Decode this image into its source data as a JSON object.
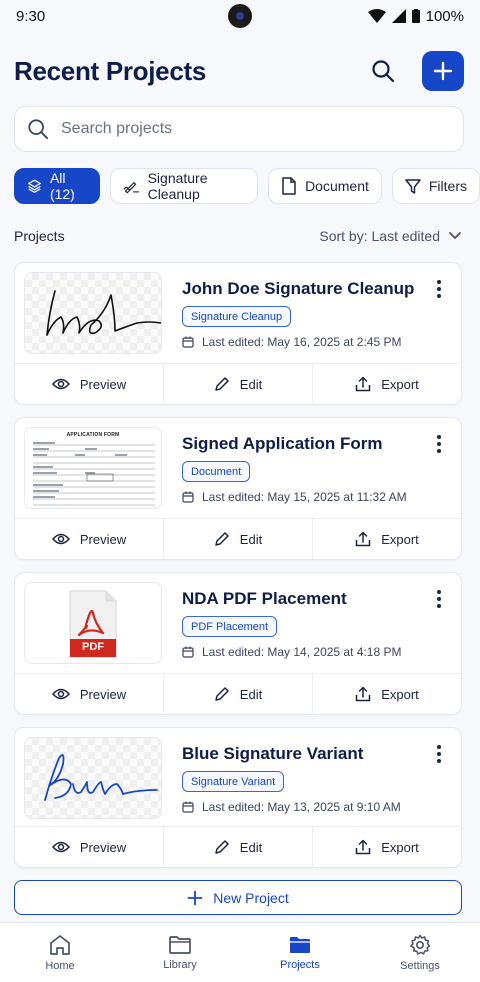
{
  "status": {
    "time": "9:30",
    "battery": "100%"
  },
  "header": {
    "title": "Recent Projects"
  },
  "search": {
    "placeholder": "Search projects"
  },
  "filters": [
    {
      "label": "All (12)",
      "icon": "layers-icon",
      "active": true
    },
    {
      "label": "Signature Cleanup",
      "icon": "signature-icon",
      "active": false
    },
    {
      "label": "Document",
      "icon": "document-icon",
      "active": false
    },
    {
      "label": "Filters",
      "icon": "funnel-icon",
      "active": false
    }
  ],
  "list": {
    "section_label": "Projects",
    "sort_label": "Sort by: Last edited"
  },
  "projects": [
    {
      "title": "John Doe Signature Cleanup",
      "tag": "Signature Cleanup",
      "edited": "Last edited: May 16, 2025 at 2:45 PM",
      "thumb": "signature-black"
    },
    {
      "title": "Signed Application Form",
      "tag": "Document",
      "edited": "Last edited: May 15, 2025 at 11:32 AM",
      "thumb": "form",
      "form_heading": "APPLICATION FORM"
    },
    {
      "title": "NDA PDF Placement",
      "tag": "PDF Placement",
      "edited": "Last edited: May 14, 2025 at 4:18 PM",
      "thumb": "pdf",
      "pdf_badge": "PDF"
    },
    {
      "title": "Blue Signature Variant",
      "tag": "Signature Variant",
      "edited": "Last edited: May 13, 2025 at 9:10 AM",
      "thumb": "signature-blue"
    }
  ],
  "actions": {
    "preview": "Preview",
    "edit": "Edit",
    "export": "Export"
  },
  "new_project_label": "New Project",
  "nav": [
    {
      "label": "Home",
      "icon": "home-icon",
      "active": false
    },
    {
      "label": "Library",
      "icon": "folder-icon",
      "active": false
    },
    {
      "label": "Projects",
      "icon": "folder-filled-icon",
      "active": true
    },
    {
      "label": "Settings",
      "icon": "gear-icon",
      "active": false
    }
  ],
  "colors": {
    "primary": "#1846c8",
    "title": "#0f1d4a",
    "pdf_red": "#d0281f"
  }
}
